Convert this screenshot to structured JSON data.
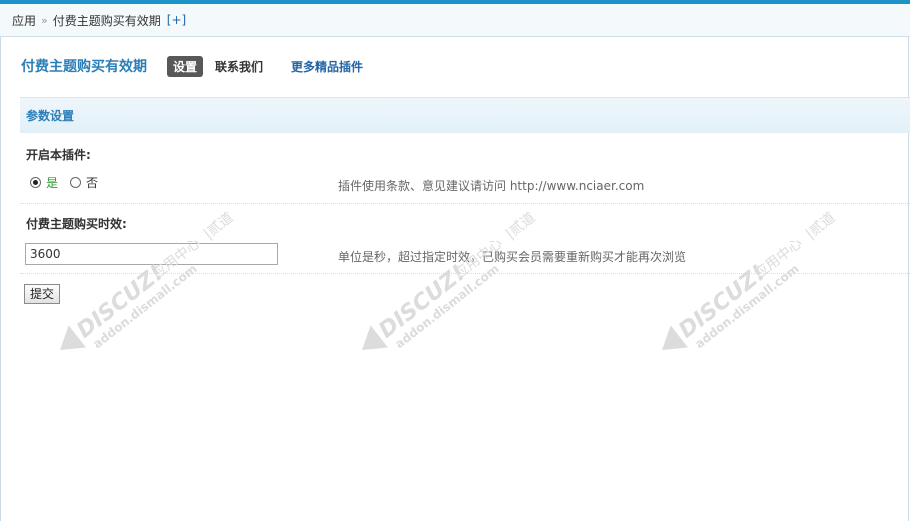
{
  "breadcrumb": {
    "root": "应用",
    "separator": "»",
    "current": "付费主题购买有效期",
    "add": "[+]"
  },
  "tabs": {
    "plugin_title": "付费主题购买有效期",
    "settings": "设置",
    "contact": "联系我们",
    "more_plugins": "更多精品插件"
  },
  "section": {
    "title": "参数设置"
  },
  "fields": {
    "enable": {
      "label": "开启本插件:",
      "option_yes": "是",
      "option_no": "否",
      "selected": "是",
      "tip": "插件使用条款、意见建议请访问 http://www.nciaer.com"
    },
    "duration": {
      "label": "付费主题购买时效:",
      "value": "3600",
      "tip": "单位是秒，超过指定时效，已购买会员需要重新购买才能再次浏览"
    }
  },
  "submit_label": "提交",
  "watermark": {
    "brand": "DISCUZ!",
    "cn": "应用中心",
    "partner": "贰道",
    "domain": "addon.dismall.com"
  },
  "colors": {
    "accent": "#1b93c9",
    "link": "#2366a8",
    "title": "#2b7fb8",
    "active_tab": "#585858",
    "yes_option": "#2a9a2a"
  }
}
